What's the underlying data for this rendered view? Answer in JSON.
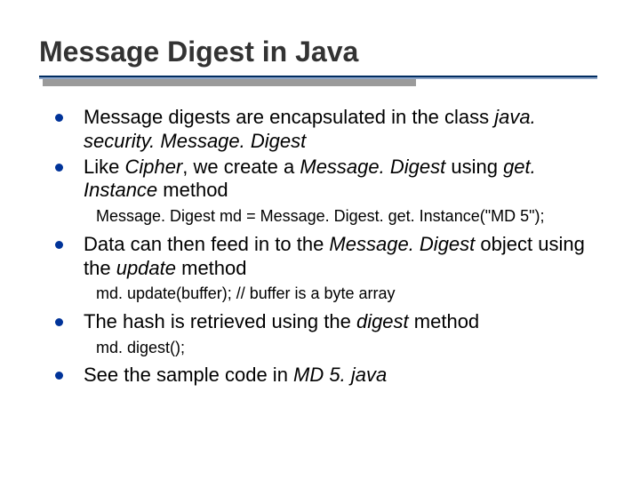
{
  "title": "Message Digest in Java",
  "bullets": {
    "b1": {
      "t1": "Message digests are encapsulated in the class ",
      "t2": "java. security. Message. Digest"
    },
    "b2": {
      "t1": "Like ",
      "t2": "Cipher",
      "t3": ", we create a ",
      "t4": "Message. Digest",
      "t5": " using ",
      "t6": "get. Instance",
      "t7": " method"
    },
    "code1": "Message. Digest md = Message. Digest. get. Instance(\"MD 5\");",
    "b3": {
      "t1": "Data can then feed in to the ",
      "t2": "Message. Digest",
      "t3": " object using the ",
      "t4": "update",
      "t5": " method"
    },
    "code2": "md. update(buffer); // buffer is a byte array",
    "b4": {
      "t1": "The hash is retrieved using the ",
      "t2": "digest",
      "t3": " method"
    },
    "code3": "md. digest();",
    "b5": {
      "t1": "See the sample code in ",
      "t2": "MD 5. java"
    }
  }
}
